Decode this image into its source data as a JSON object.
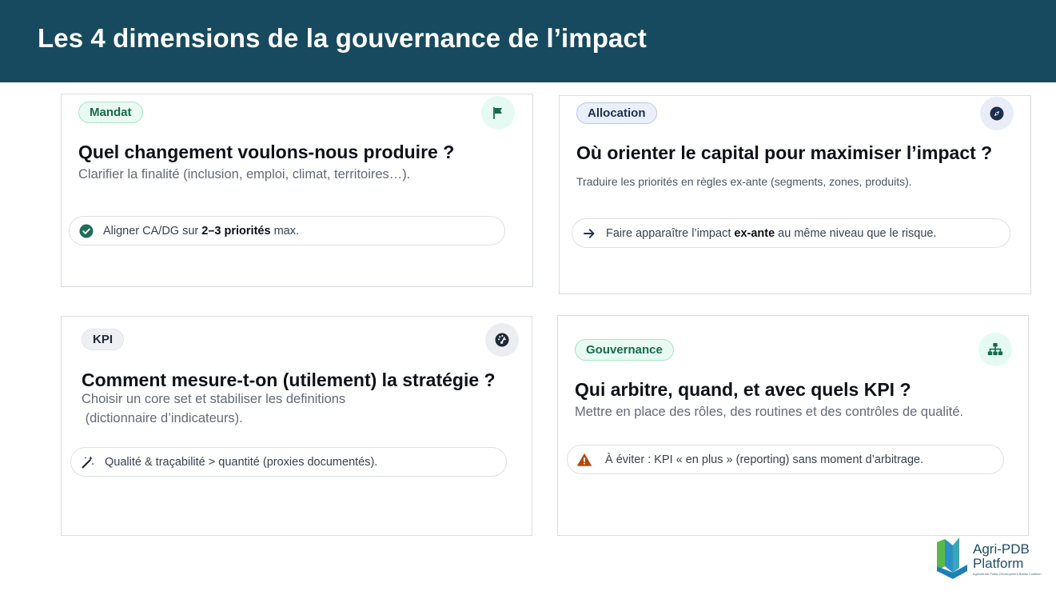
{
  "slide": {
    "title": "Les 4 dimensions de la gouvernance de l’impact"
  },
  "cards": {
    "mandat": {
      "tag": "Mandat",
      "icon": "flag-icon",
      "question": "Quel changement voulons-nous produire ?",
      "description": "Clarifier la finalité (inclusion, emploi, climat, territoires…).",
      "point_pre": "Aligner CA/DG sur ",
      "point_bold": "2–3 priorités",
      "point_post": " max."
    },
    "allocation": {
      "tag": "Allocation",
      "icon": "compass-icon",
      "question": "Où orienter le capital pour maximiser l’impact ?",
      "description": "Traduire les priorités en règles ex-ante (segments, zones, produits).",
      "point_pre": "Faire apparaître l’impact ",
      "point_bold": "ex-ante",
      "point_post": " au même niveau que le risque."
    },
    "kpi": {
      "tag": "KPI",
      "icon": "gauge-icon",
      "question": "Comment mesure-t-on (utilement) la stratégie ?",
      "description_line1": "Choisir un core set et stabiliser les definitions",
      "description_line2": " (dictionnaire d’indicateurs).",
      "point": "Qualité & traçabilité > quantité (proxies documentés)."
    },
    "gouvernance": {
      "tag": "Gouvernance",
      "icon": "org-chart-icon",
      "question": "Qui arbitre, quand, et avec quels KPI ?",
      "description": "Mettre en place des rôles, des routines et des contrôles de qualité.",
      "point": "À éviter : KPI « en plus » (reporting) sans moment d’arbitrage."
    }
  },
  "logo": {
    "name_line1": "Agri-PDB",
    "name_line2": "Platform",
    "tagline": "Agricultural Public Development Banks Coalition"
  },
  "colors": {
    "header": "#174a5e",
    "green_tag": "#156b4c",
    "check": "#1f6e57",
    "warning": "#b54708",
    "logo_green": "#59b84a",
    "logo_blue": "#2b8fc9"
  }
}
